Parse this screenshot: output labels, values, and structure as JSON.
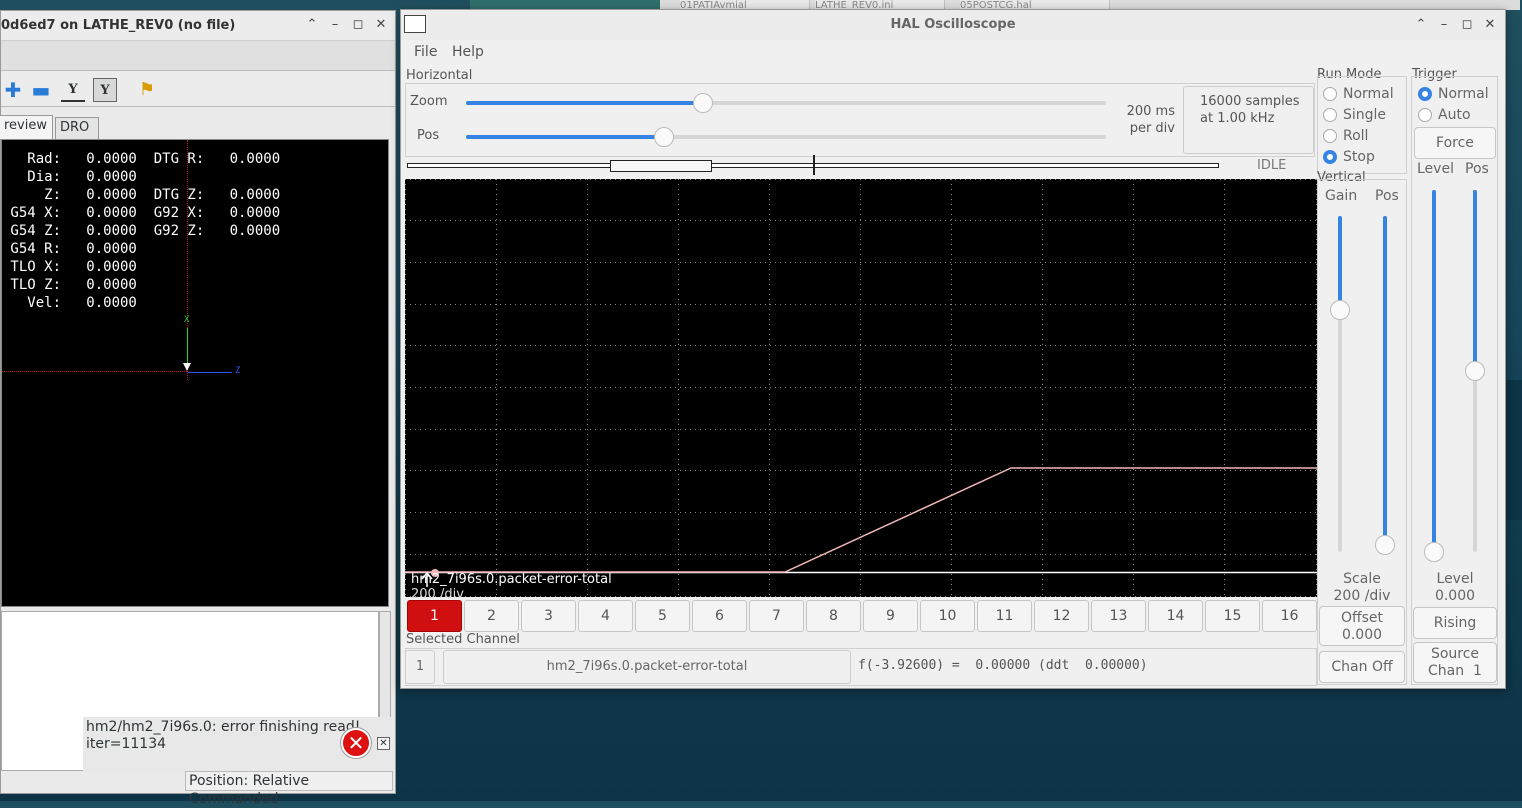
{
  "background_tabs": [
    "01PATIAvmial",
    "LATHE_REV0.ini",
    "05POSTCG.hal"
  ],
  "axis": {
    "title": "0d6ed7 on LATHE_REV0 (no file)",
    "tabs": [
      "review",
      "DRO"
    ],
    "dro_lines": [
      "   Rad:   0.0000  DTG R:   0.0000",
      "   Dia:   0.0000",
      "     Z:   0.0000  DTG Z:   0.0000",
      " G54 X:   0.0000  G92 X:   0.0000",
      " G54 Z:   0.0000  G92 Z:   0.0000",
      " G54 R:   0.0000",
      " TLO X:   0.0000",
      " TLO Z:   0.0000",
      "   Vel:   0.0000"
    ],
    "gnomon_x": "X",
    "gnomon_z": "Z",
    "error_text": "hm2/hm2_7i96s.0: error finishing read!\niter=11134",
    "status": "Position: Relative Commanded"
  },
  "scope": {
    "title": "HAL Oscilloscope",
    "menu": [
      "File",
      "Help"
    ],
    "horizontal": {
      "label": "Horizontal",
      "zoom_label": "Zoom",
      "pos_label": "Pos",
      "zoom_fraction": 0.37,
      "pos_fraction": 0.31,
      "rate": "200 ms\nper div",
      "samples": "16000 samples\nat 1.00 kHz"
    },
    "state": "IDLE",
    "trace": {
      "color": "#f2b8b8",
      "channel_name": "hm2_7i96s.0.packet-error-total",
      "scale_partial": "200 /div"
    },
    "channel_buttons": [
      "1",
      "2",
      "3",
      "4",
      "5",
      "6",
      "7",
      "8",
      "9",
      "10",
      "11",
      "12",
      "13",
      "14",
      "15",
      "16"
    ],
    "selected_channel_index": 0,
    "selected": {
      "label": "Selected Channel",
      "num": "1",
      "name": "hm2_7i96s.0.packet-error-total",
      "value": "f(-3.92600) =  0.00000 (ddt  0.00000)"
    },
    "run_mode": {
      "label": "Run Mode",
      "options": [
        "Normal",
        "Single",
        "Roll",
        "Stop"
      ],
      "selected": "Stop"
    },
    "trigger": {
      "label": "Trigger",
      "options": [
        "Normal",
        "Auto"
      ],
      "selected": "Normal",
      "force": "Force",
      "level_label": "Level",
      "pos_label": "Pos",
      "level_fraction": 0.0,
      "pos_fraction": 0.5,
      "level_readout": "Level\n0.000",
      "edge": "Rising",
      "source": "Source\nChan  1"
    },
    "vertical": {
      "label": "Vertical",
      "gain_label": "Gain",
      "pos_label": "Pos",
      "gain_fraction": 0.72,
      "pos_fraction": 0.02,
      "scale": "Scale\n200 /div",
      "offset": "Offset\n0.000",
      "chan_off": "Chan Off"
    },
    "accent_color": "#3584e4",
    "selected_channel_color": "#d01010"
  }
}
